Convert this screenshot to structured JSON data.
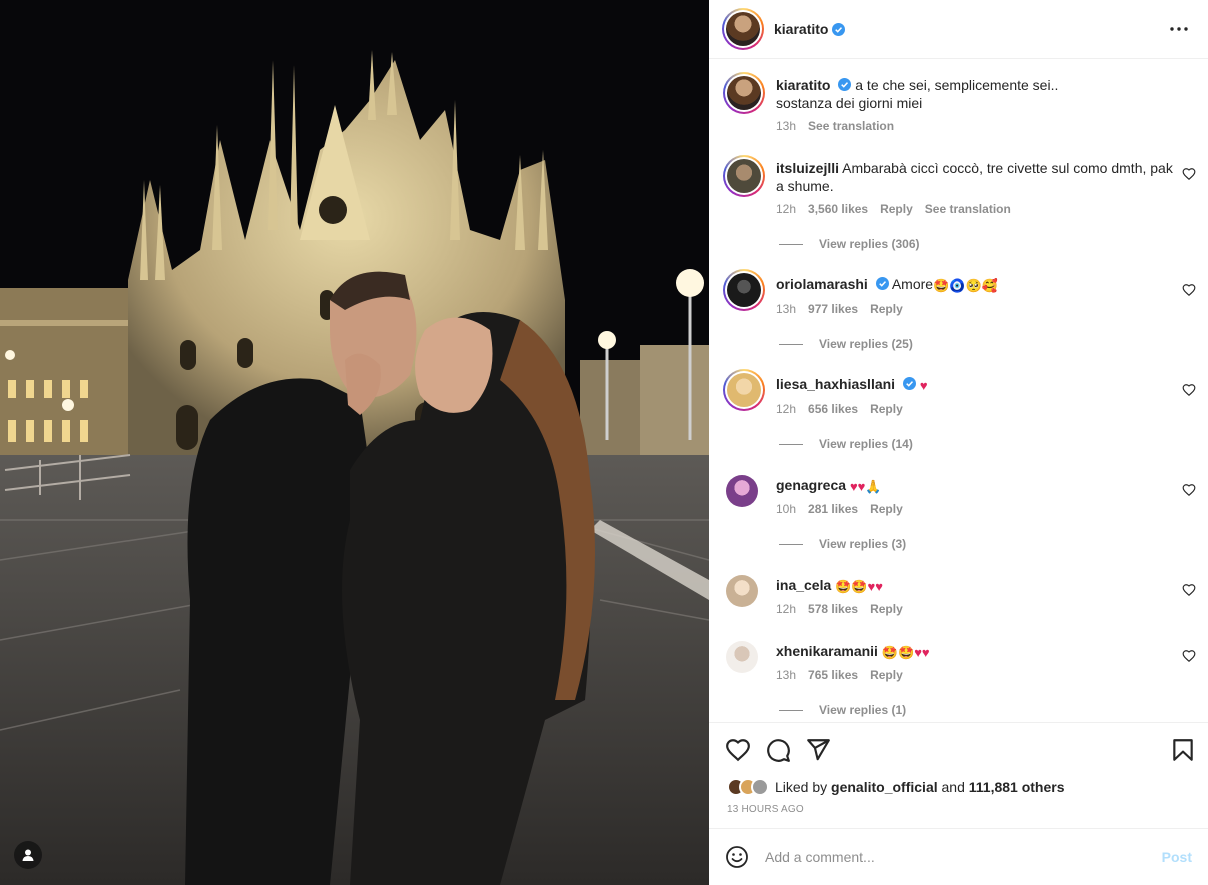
{
  "post": {
    "author": "kiaratito",
    "caption_line1": "a te che sei, semplicemente sei..",
    "caption_line2": "sostanza dei giorni miei",
    "caption_time": "13h",
    "see_translation": "See translation"
  },
  "comments": [
    {
      "user": "itsluizejlli",
      "text": "Ambarabà ciccì coccò, tre civette sul como dmth, pak a shume.",
      "time": "12h",
      "likes": "3,560 likes",
      "reply": "Reply",
      "translate": "See translation",
      "replies": "View replies (306)"
    },
    {
      "user": "oriolamarashi",
      "text": "Amore",
      "emojis": "🤩🧿🥺🥰",
      "time": "13h",
      "likes": "977 likes",
      "reply": "Reply",
      "replies": "View replies (25)"
    },
    {
      "user": "liesa_haxhiasllani",
      "emojis": "♥",
      "time": "12h",
      "likes": "656 likes",
      "reply": "Reply",
      "replies": "View replies (14)"
    },
    {
      "user": "genagreca",
      "emojis": "♥♥",
      "emojis2": "🙏",
      "time": "10h",
      "likes": "281 likes",
      "reply": "Reply",
      "replies": "View replies (3)"
    },
    {
      "user": "ina_cela",
      "emojis": "🤩🤩",
      "emojis2": "♥♥",
      "time": "12h",
      "likes": "578 likes",
      "reply": "Reply"
    },
    {
      "user": "xhenikaramanii",
      "emojis": "🤩🤩",
      "emojis2": "♥♥",
      "time": "13h",
      "likes": "765 likes",
      "reply": "Reply",
      "replies": "View replies (1)"
    }
  ],
  "likes": {
    "prefix": "Liked by",
    "user": "genalito_official",
    "middle": "and",
    "others": "111,881 others"
  },
  "timeago": "13 HOURS AGO",
  "add_comment": {
    "placeholder": "Add a comment...",
    "post_label": "Post"
  },
  "colors": {
    "verified": "#3897f0",
    "heart": "#e0245e",
    "post_disabled": "#b2dffc",
    "muted": "#8e8e8e"
  },
  "icons": [
    "more-icon",
    "verified-icon",
    "heart-icon",
    "comment-icon",
    "share-icon",
    "bookmark-icon",
    "emoji-icon",
    "user-tag-icon"
  ]
}
